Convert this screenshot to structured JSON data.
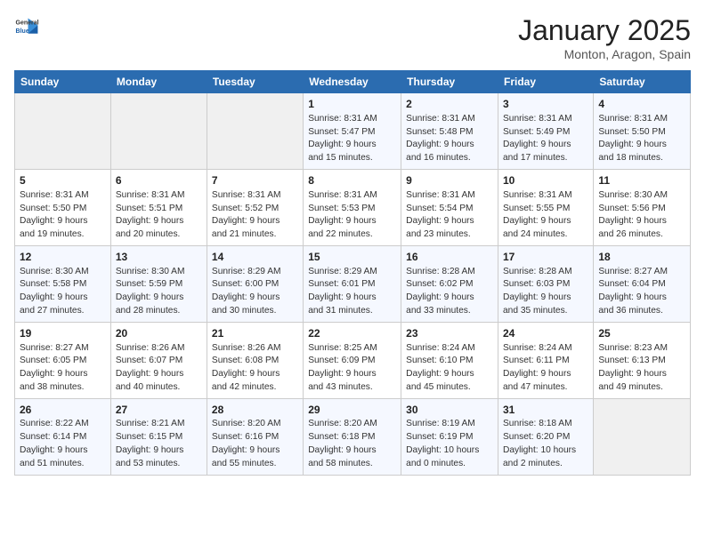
{
  "logo": {
    "general": "General",
    "blue": "Blue"
  },
  "header": {
    "month": "January 2025",
    "location": "Monton, Aragon, Spain"
  },
  "weekdays": [
    "Sunday",
    "Monday",
    "Tuesday",
    "Wednesday",
    "Thursday",
    "Friday",
    "Saturday"
  ],
  "weeks": [
    [
      {
        "day": "",
        "content": ""
      },
      {
        "day": "",
        "content": ""
      },
      {
        "day": "",
        "content": ""
      },
      {
        "day": "1",
        "content": "Sunrise: 8:31 AM\nSunset: 5:47 PM\nDaylight: 9 hours\nand 15 minutes."
      },
      {
        "day": "2",
        "content": "Sunrise: 8:31 AM\nSunset: 5:48 PM\nDaylight: 9 hours\nand 16 minutes."
      },
      {
        "day": "3",
        "content": "Sunrise: 8:31 AM\nSunset: 5:49 PM\nDaylight: 9 hours\nand 17 minutes."
      },
      {
        "day": "4",
        "content": "Sunrise: 8:31 AM\nSunset: 5:50 PM\nDaylight: 9 hours\nand 18 minutes."
      }
    ],
    [
      {
        "day": "5",
        "content": "Sunrise: 8:31 AM\nSunset: 5:50 PM\nDaylight: 9 hours\nand 19 minutes."
      },
      {
        "day": "6",
        "content": "Sunrise: 8:31 AM\nSunset: 5:51 PM\nDaylight: 9 hours\nand 20 minutes."
      },
      {
        "day": "7",
        "content": "Sunrise: 8:31 AM\nSunset: 5:52 PM\nDaylight: 9 hours\nand 21 minutes."
      },
      {
        "day": "8",
        "content": "Sunrise: 8:31 AM\nSunset: 5:53 PM\nDaylight: 9 hours\nand 22 minutes."
      },
      {
        "day": "9",
        "content": "Sunrise: 8:31 AM\nSunset: 5:54 PM\nDaylight: 9 hours\nand 23 minutes."
      },
      {
        "day": "10",
        "content": "Sunrise: 8:31 AM\nSunset: 5:55 PM\nDaylight: 9 hours\nand 24 minutes."
      },
      {
        "day": "11",
        "content": "Sunrise: 8:30 AM\nSunset: 5:56 PM\nDaylight: 9 hours\nand 26 minutes."
      }
    ],
    [
      {
        "day": "12",
        "content": "Sunrise: 8:30 AM\nSunset: 5:58 PM\nDaylight: 9 hours\nand 27 minutes."
      },
      {
        "day": "13",
        "content": "Sunrise: 8:30 AM\nSunset: 5:59 PM\nDaylight: 9 hours\nand 28 minutes."
      },
      {
        "day": "14",
        "content": "Sunrise: 8:29 AM\nSunset: 6:00 PM\nDaylight: 9 hours\nand 30 minutes."
      },
      {
        "day": "15",
        "content": "Sunrise: 8:29 AM\nSunset: 6:01 PM\nDaylight: 9 hours\nand 31 minutes."
      },
      {
        "day": "16",
        "content": "Sunrise: 8:28 AM\nSunset: 6:02 PM\nDaylight: 9 hours\nand 33 minutes."
      },
      {
        "day": "17",
        "content": "Sunrise: 8:28 AM\nSunset: 6:03 PM\nDaylight: 9 hours\nand 35 minutes."
      },
      {
        "day": "18",
        "content": "Sunrise: 8:27 AM\nSunset: 6:04 PM\nDaylight: 9 hours\nand 36 minutes."
      }
    ],
    [
      {
        "day": "19",
        "content": "Sunrise: 8:27 AM\nSunset: 6:05 PM\nDaylight: 9 hours\nand 38 minutes."
      },
      {
        "day": "20",
        "content": "Sunrise: 8:26 AM\nSunset: 6:07 PM\nDaylight: 9 hours\nand 40 minutes."
      },
      {
        "day": "21",
        "content": "Sunrise: 8:26 AM\nSunset: 6:08 PM\nDaylight: 9 hours\nand 42 minutes."
      },
      {
        "day": "22",
        "content": "Sunrise: 8:25 AM\nSunset: 6:09 PM\nDaylight: 9 hours\nand 43 minutes."
      },
      {
        "day": "23",
        "content": "Sunrise: 8:24 AM\nSunset: 6:10 PM\nDaylight: 9 hours\nand 45 minutes."
      },
      {
        "day": "24",
        "content": "Sunrise: 8:24 AM\nSunset: 6:11 PM\nDaylight: 9 hours\nand 47 minutes."
      },
      {
        "day": "25",
        "content": "Sunrise: 8:23 AM\nSunset: 6:13 PM\nDaylight: 9 hours\nand 49 minutes."
      }
    ],
    [
      {
        "day": "26",
        "content": "Sunrise: 8:22 AM\nSunset: 6:14 PM\nDaylight: 9 hours\nand 51 minutes."
      },
      {
        "day": "27",
        "content": "Sunrise: 8:21 AM\nSunset: 6:15 PM\nDaylight: 9 hours\nand 53 minutes."
      },
      {
        "day": "28",
        "content": "Sunrise: 8:20 AM\nSunset: 6:16 PM\nDaylight: 9 hours\nand 55 minutes."
      },
      {
        "day": "29",
        "content": "Sunrise: 8:20 AM\nSunset: 6:18 PM\nDaylight: 9 hours\nand 58 minutes."
      },
      {
        "day": "30",
        "content": "Sunrise: 8:19 AM\nSunset: 6:19 PM\nDaylight: 10 hours\nand 0 minutes."
      },
      {
        "day": "31",
        "content": "Sunrise: 8:18 AM\nSunset: 6:20 PM\nDaylight: 10 hours\nand 2 minutes."
      },
      {
        "day": "",
        "content": ""
      }
    ]
  ]
}
